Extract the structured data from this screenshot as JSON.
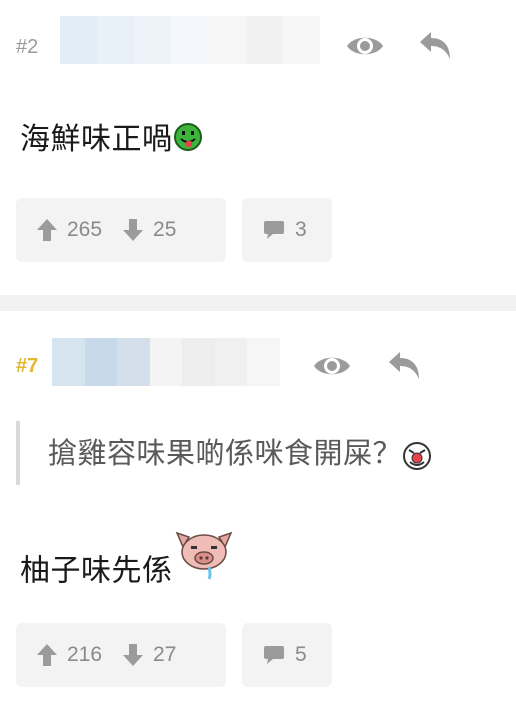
{
  "posts": [
    {
      "number": "#2",
      "body": "海鮮味正喎",
      "emoji": "green-tongue-smiley",
      "upvotes": "265",
      "downvotes": "25",
      "replies": "3"
    },
    {
      "number": "#7",
      "quote": "搶雞容味果啲係咪食開屎？",
      "quote_emoji": "red-nose-clown-smiley",
      "body": "柚子味先係",
      "emoji": "pig-head-sticker",
      "upvotes": "216",
      "downvotes": "27",
      "replies": "5"
    }
  ],
  "colors": {
    "accent_number": "#e3b62e",
    "muted_number": "#9a9a9a",
    "icon_gray": "#9b9b9b",
    "button_bg": "#f3f3f3",
    "separator": "#f2f2f2"
  }
}
